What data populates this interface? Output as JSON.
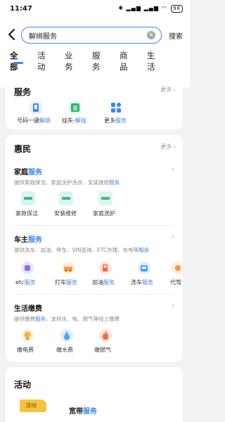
{
  "status_bar": {
    "time": "11:47",
    "battery": "98"
  },
  "search": {
    "value": "解绑服务",
    "button_label": "搜索"
  },
  "tabs": [
    {
      "label": "全部"
    },
    {
      "label": "活动"
    },
    {
      "label": "业务"
    },
    {
      "label": "服务"
    },
    {
      "label": "商品"
    },
    {
      "label": "生活"
    }
  ],
  "services": {
    "title": "服务",
    "more": "更多",
    "items": [
      {
        "prefix": "号码一键",
        "highlight": "解绑"
      },
      {
        "prefix": "挂失-",
        "highlight": "解挂"
      },
      {
        "prefix": "更多",
        "highlight": "服务"
      }
    ]
  },
  "huimin": {
    "title": "惠民",
    "more": "更多",
    "home_service": {
      "title_prefix": "家庭",
      "title_highlight": "服务",
      "desc_prefix": "提供家政保洁、家庭洗护洗衣、安装维修",
      "desc_highlight": "服务",
      "items": [
        "家政保洁",
        "安装维修",
        "家庭洗护"
      ]
    },
    "car_service": {
      "title_prefix": "车主",
      "title_highlight": "服务",
      "desc_prefix": "提供洗车、加油、停车、VIN查询、ETC办理、充电等",
      "desc_highlight": "服务",
      "items": [
        {
          "prefix": "etc",
          "highlight": "服务"
        },
        {
          "prefix": "打车",
          "highlight": "服务"
        },
        {
          "prefix": "加油",
          "highlight": "服务"
        },
        {
          "prefix": "洗车",
          "highlight": "服务"
        },
        {
          "prefix": "代驾",
          "highlight": ""
        }
      ]
    },
    "bills": {
      "title": "生活缴费",
      "desc_pre": "提供缴费",
      "desc_highlight": "服务",
      "desc_post": "，支持水、电、燃气等线上缴费",
      "items": [
        "缴电费",
        "缴水费",
        "缴燃气"
      ]
    }
  },
  "activity": {
    "title": "活动",
    "badge": "活动",
    "item_prefix": "宽带",
    "item_highlight": "服务"
  },
  "colors": {
    "accent": "#3b86f4",
    "tile_green": "#dcf3ee",
    "etc_purple": "#8d6cf0",
    "orange": "#f59a3b",
    "red_orange": "#f2683b",
    "water_blue": "#4ea4f5",
    "badge_yellow": "#f8c33c"
  }
}
